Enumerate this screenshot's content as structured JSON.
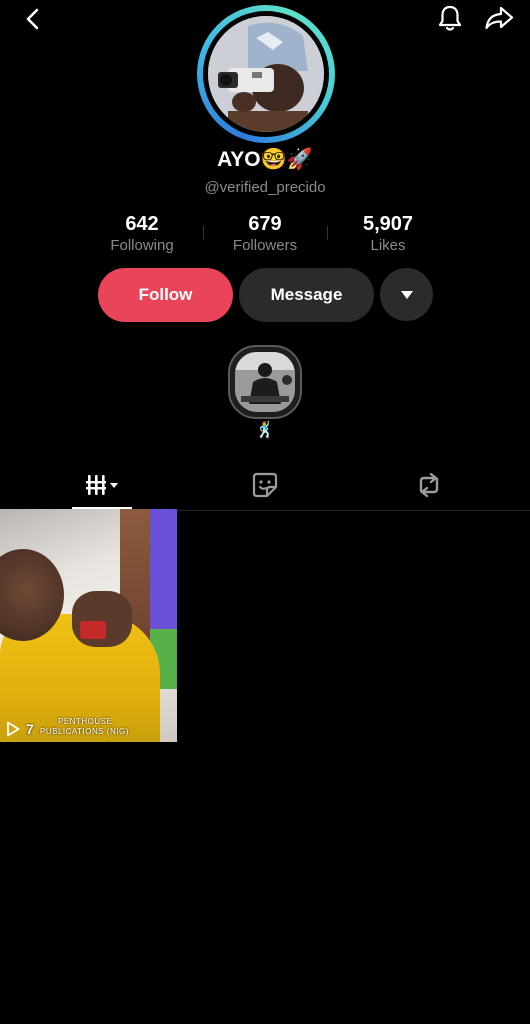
{
  "header": {
    "back_icon": "chevron-left-icon",
    "bell_icon": "bell-icon",
    "share_icon": "share-arrow-icon"
  },
  "profile": {
    "display_name": "AYO🤓🚀",
    "username": "@verified_precido"
  },
  "stats": [
    {
      "value": "642",
      "label": "Following"
    },
    {
      "value": "679",
      "label": "Followers"
    },
    {
      "value": "5,907",
      "label": "Likes"
    }
  ],
  "actions": {
    "follow_label": "Follow",
    "message_label": "Message",
    "more_icon": "caret-down-icon"
  },
  "story": {
    "caption": "🕺"
  },
  "tabs": [
    {
      "name": "videos",
      "icon": "grid-icon",
      "active": true
    },
    {
      "name": "stickers",
      "icon": "sticker-icon",
      "active": false
    },
    {
      "name": "reposts",
      "icon": "repost-icon",
      "active": false
    }
  ],
  "videos": [
    {
      "views": "7",
      "watermark_line1": "PENTHOUSE",
      "watermark_line2": "PUBLICATIONS (NIG)"
    }
  ],
  "colors": {
    "follow": "#ea445a",
    "background": "#000000",
    "secondary_text": "#8a8a8e"
  }
}
